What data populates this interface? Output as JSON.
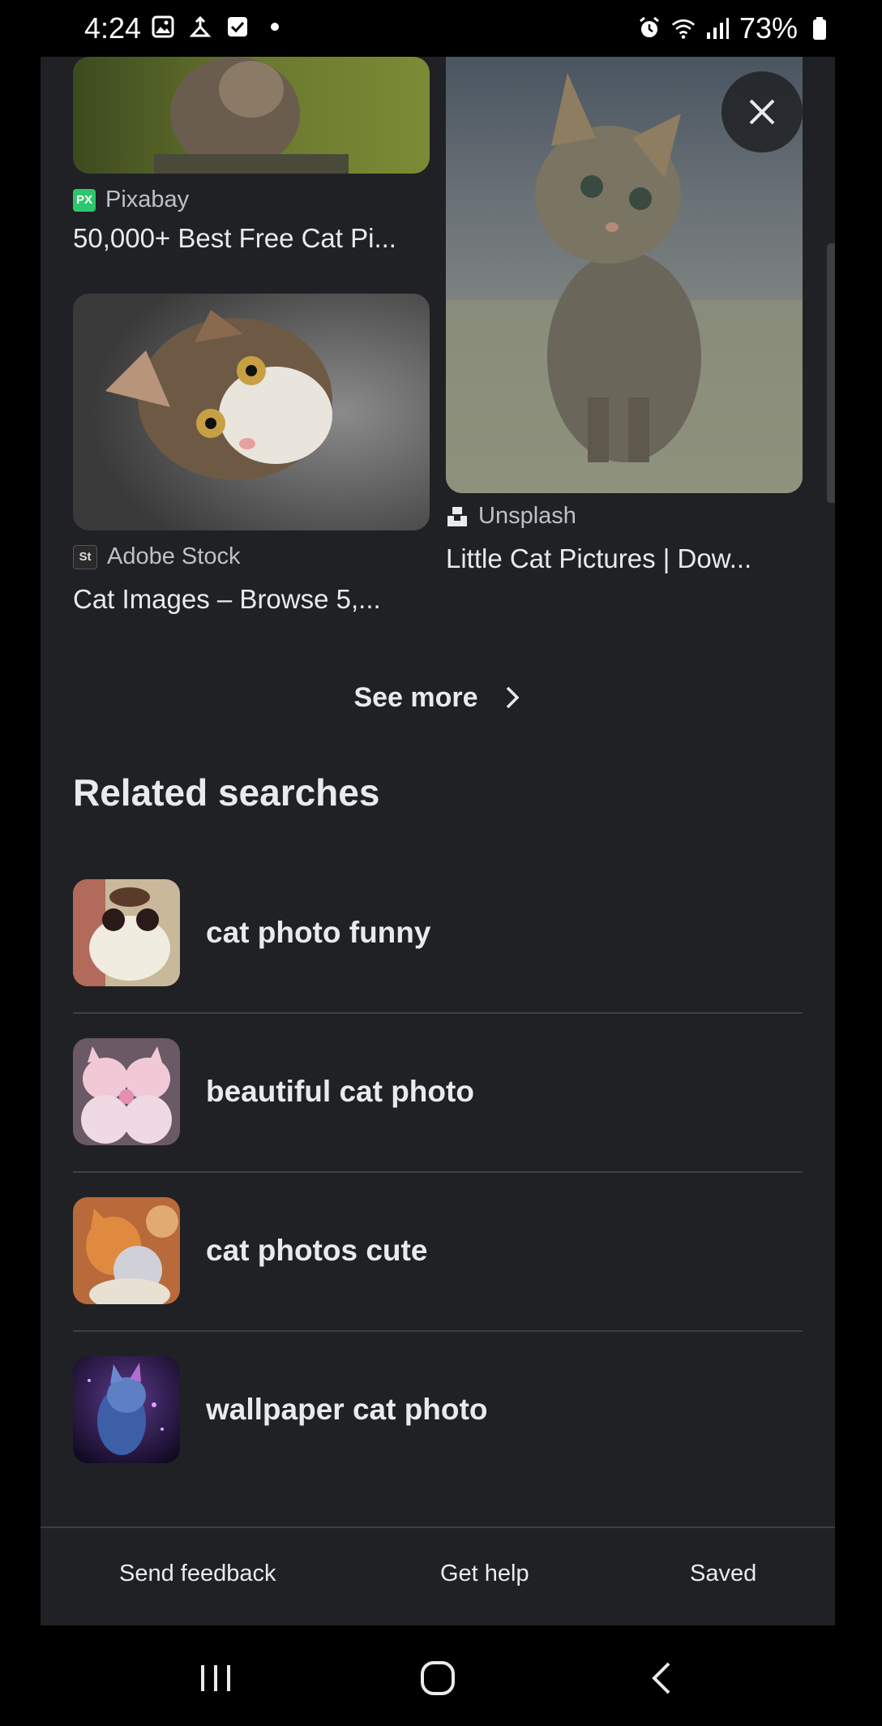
{
  "status_bar": {
    "time": "4:24",
    "left_icons": [
      "gallery-icon",
      "upload-icon",
      "checkbox-icon",
      "dot-icon"
    ],
    "battery": "73%",
    "right_icons": [
      "alarm-icon",
      "wifi-icon",
      "signal-icon",
      "battery-icon"
    ]
  },
  "results": [
    {
      "source": "Pixabay",
      "source_badge": "PX",
      "title": "50,000+ Best Free Cat Pi..."
    },
    {
      "source": "Adobe Stock",
      "source_badge": "St",
      "title": "Cat Images – Browse 5,..."
    },
    {
      "source": "Unsplash",
      "source_badge": "",
      "title": "Little Cat Pictures | Dow..."
    }
  ],
  "see_more": {
    "label": "See more"
  },
  "related": {
    "title": "Related searches",
    "items": [
      {
        "label": "cat photo funny"
      },
      {
        "label": "beautiful cat photo"
      },
      {
        "label": "cat photos cute"
      },
      {
        "label": "wallpaper cat photo"
      }
    ]
  },
  "footer": {
    "send_feedback": "Send feedback",
    "get_help": "Get help",
    "saved": "Saved"
  },
  "navbar": [
    "recents-icon",
    "home-icon",
    "back-icon"
  ],
  "colors": {
    "sheet_bg": "#202124",
    "text": "#e8eaed",
    "muted": "#bdc1c6",
    "divider": "#3c4043"
  }
}
